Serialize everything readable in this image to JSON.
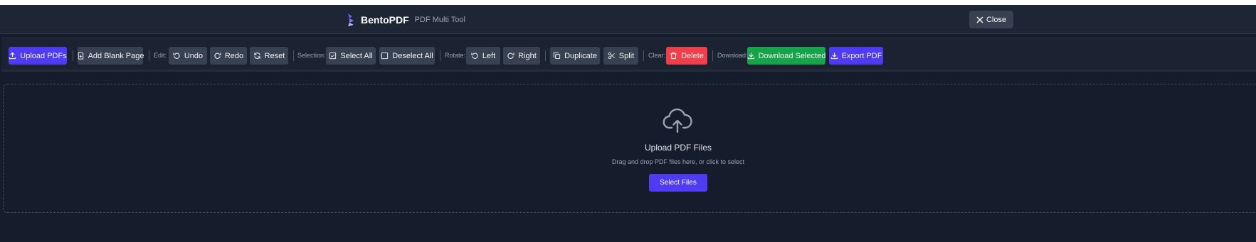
{
  "header": {
    "brand_name": "BentoPDF",
    "brand_subtitle": "PDF Multi Tool",
    "close_label": "Close"
  },
  "toolbar": {
    "upload_label": "Upload PDFs",
    "add_blank_label": "Add Blank Page",
    "edit_label": "Edit:",
    "undo_label": "Undo",
    "redo_label": "Redo",
    "reset_label": "Reset",
    "selection_label": "Selection:",
    "select_all_label": "Select All",
    "deselect_all_label": "Deselect All",
    "rotate_label": "Rotate:",
    "left_label": "Left",
    "right_label": "Right",
    "duplicate_label": "Duplicate",
    "split_label": "Split",
    "clear_label": "Clear:",
    "delete_label": "Delete",
    "download_label": "Download:",
    "download_selected_label": "Download Selected",
    "export_label": "Export PDF"
  },
  "dropzone": {
    "icon": "cloud-upload-icon",
    "title": "Upload PDF Files",
    "subtitle": "Drag and drop PDF files here, or click to select",
    "button_label": "Select Files"
  },
  "colors": {
    "primary": "#4f3bf2",
    "danger": "#ef3f4a",
    "success": "#16a34a",
    "background": "#151c2b"
  }
}
